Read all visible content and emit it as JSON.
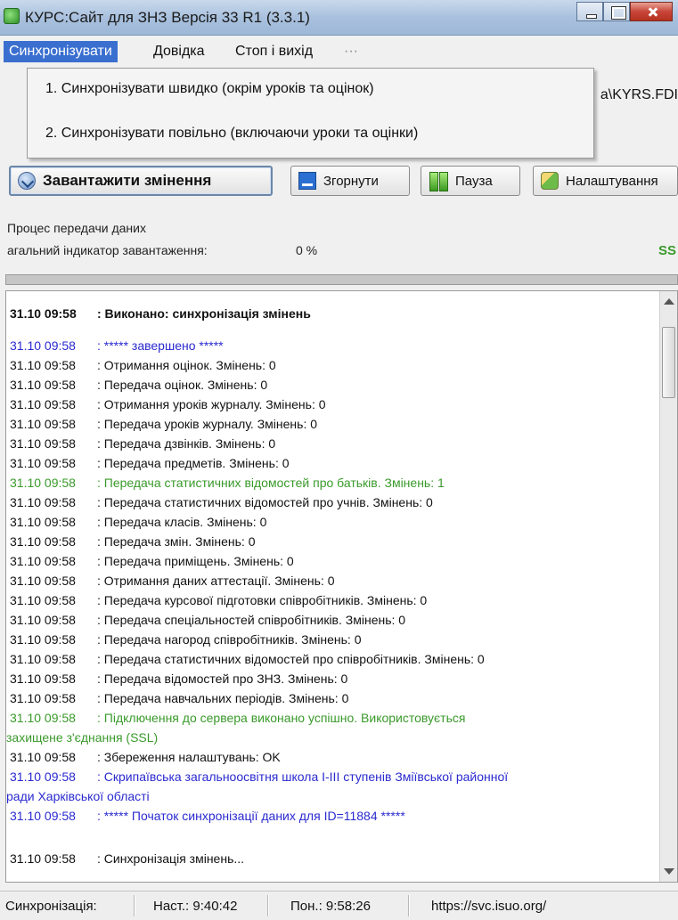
{
  "window": {
    "title": "КУРС:Сайт для ЗНЗ   Версія 33 R1 (3.3.1)"
  },
  "menu": {
    "items": [
      "Синхронізувати",
      "Довідка",
      "Стоп і вихід",
      "···"
    ]
  },
  "path_text": "а\\KYRS.FDI",
  "dropdown": {
    "items": [
      "1. Синхронізувати швидко (окрім уроків та оцінок)",
      "2. Синхронізувати повільно (включаючи уроки та оцінки)"
    ]
  },
  "toolbar": {
    "load_label": "Завантажити змінення",
    "collapse_label": "Згорнути",
    "pause_label": "Пауза",
    "settings_label": "Налаштування"
  },
  "progress": {
    "process_label": "Процес передачи даних",
    "indicator_label": "агальний індикатор завантаження:",
    "indicator_value": "0 %",
    "ssl_label": "SS",
    "fill_percent": 0
  },
  "log": {
    "lines": [
      {
        "time": "31.10  09:58",
        "text": ": Виконано: синхронізація змінень",
        "style": "bold"
      },
      {
        "time": "31.10  09:58",
        "text": ": ***** завершено *****",
        "style": "blue"
      },
      {
        "time": "31.10  09:58",
        "text": ": Отримання оцінок. Змінень: 0",
        "style": "normal"
      },
      {
        "time": "31.10  09:58",
        "text": ": Передача оцінок. Змінень: 0",
        "style": "normal"
      },
      {
        "time": "31.10  09:58",
        "text": ": Отримання уроків журналу. Змінень: 0",
        "style": "normal"
      },
      {
        "time": "31.10  09:58",
        "text": ": Передача уроків журналу. Змінень: 0",
        "style": "normal"
      },
      {
        "time": "31.10  09:58",
        "text": ": Передача дзвінків. Змінень: 0",
        "style": "normal"
      },
      {
        "time": "31.10  09:58",
        "text": ": Передача предметів. Змінень: 0",
        "style": "normal"
      },
      {
        "time": "31.10  09:58",
        "text": ": Передача статистичних відомостей про батьків. Змінень: 1",
        "style": "green"
      },
      {
        "time": "31.10  09:58",
        "text": ": Передача статистичних відомостей про учнів. Змінень: 0",
        "style": "normal"
      },
      {
        "time": "31.10  09:58",
        "text": ": Передача класів. Змінень: 0",
        "style": "normal"
      },
      {
        "time": "31.10  09:58",
        "text": ": Передача змін. Змінень: 0",
        "style": "normal"
      },
      {
        "time": "31.10  09:58",
        "text": ": Передача приміщень. Змінень: 0",
        "style": "normal"
      },
      {
        "time": "31.10  09:58",
        "text": ": Отримання даних аттестації. Змінень: 0",
        "style": "normal"
      },
      {
        "time": "31.10  09:58",
        "text": ": Передача курсової підготовки співробітників. Змінень: 0",
        "style": "normal"
      },
      {
        "time": "31.10  09:58",
        "text": ": Передача спеціальностей співробітників. Змінень: 0",
        "style": "normal"
      },
      {
        "time": "31.10  09:58",
        "text": ": Передача нагород співробітників. Змінень: 0",
        "style": "normal"
      },
      {
        "time": "31.10  09:58",
        "text": ": Передача статистичних відомостей про співробітників. Змінень: 0",
        "style": "normal"
      },
      {
        "time": "31.10  09:58",
        "text": ": Передача відомостей про ЗНЗ. Змінень: 0",
        "style": "normal"
      },
      {
        "time": "31.10  09:58",
        "text": ": Передача навчальних періодів. Змінень: 0",
        "style": "normal"
      },
      {
        "time": "31.10  09:58",
        "text": ": Підключення до сервера виконано успішно. Використовується",
        "style": "green"
      },
      {
        "time": "",
        "text": "захищене з'єднання (SSL)",
        "style": "green"
      },
      {
        "time": "31.10  09:58",
        "text": ": Збереження налаштувань: OK",
        "style": "normal"
      },
      {
        "time": "31.10  09:58",
        "text": ": Скрипаївська загальноосвітня школа І-ІІІ ступенів Зміївської районної",
        "style": "blue"
      },
      {
        "time": "",
        "text": "ради Харківської області",
        "style": "blue"
      },
      {
        "time": "31.10  09:58",
        "text": ": ***** Початок синхронізації даних для ID=11884 *****",
        "style": "blue"
      },
      {
        "time": "31.10  09:58",
        "text": ": Синхронізація змінень...",
        "style": "normal"
      }
    ]
  },
  "status": {
    "mode": "Синхронізація:",
    "start": "Наст.: 9:40:42",
    "last": "Пон.: 9:58:26",
    "url": "https://svc.isuo.org/"
  }
}
